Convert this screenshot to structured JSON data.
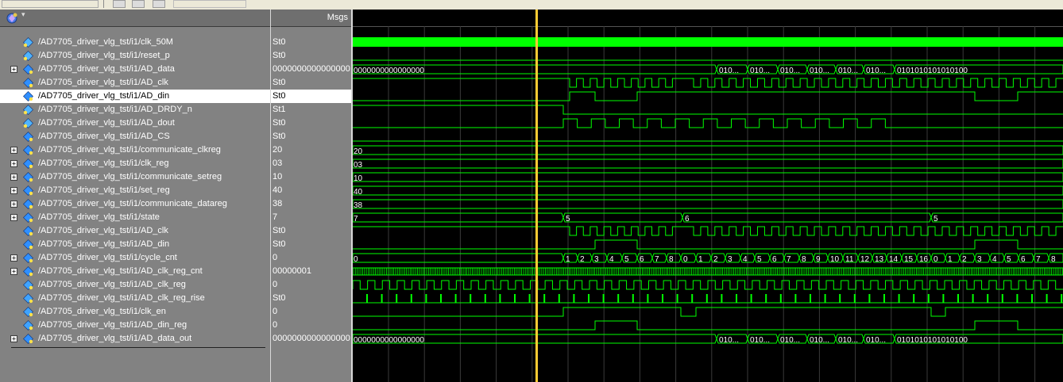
{
  "values_header": "Msgs",
  "cursor_time_fraction": 0.258,
  "colors": {
    "wave": "#00ff00",
    "cursor": "#ffcc33",
    "grid": "#3a3a3a",
    "bus_text": "#ffffff",
    "background": "#000000"
  },
  "signals": [
    {
      "name": "/AD7705_driver_vlg_tst/i1/clk_50M",
      "value": "St0",
      "expandable": false,
      "icon": "input-signal-icon",
      "wave": {
        "kind": "fill"
      }
    },
    {
      "name": "/AD7705_driver_vlg_tst/i1/reset_p",
      "value": "St0",
      "expandable": false,
      "icon": "input-signal-icon",
      "wave": {
        "kind": "low"
      }
    },
    {
      "name": "/AD7705_driver_vlg_tst/i1/AD_data",
      "value": "0000000000000000",
      "expandable": true,
      "icon": "bus-signal-icon",
      "wave": {
        "kind": "bus",
        "segments": [
          {
            "from": 0,
            "to": 458,
            "label": "0000000000000000"
          },
          {
            "from": 458,
            "to": 497,
            "label": "010..."
          },
          {
            "from": 497,
            "to": 535,
            "label": "010..."
          },
          {
            "from": 535,
            "to": 572,
            "label": "010..."
          },
          {
            "from": 572,
            "to": 608,
            "label": "010..."
          },
          {
            "from": 608,
            "to": 643,
            "label": "010..."
          },
          {
            "from": 643,
            "to": 682,
            "label": "010..."
          },
          {
            "from": 682,
            "to": 894,
            "label": "0101010101010100"
          }
        ]
      }
    },
    {
      "name": "/AD7705_driver_vlg_tst/i1/AD_clk",
      "value": "St0",
      "expandable": false,
      "icon": "output-signal-icon",
      "wave": {
        "kind": "clock",
        "idle": "high",
        "bursts": [
          [
            273,
            411,
            8
          ],
          [
            429,
            894,
            26
          ]
        ]
      }
    },
    {
      "name": "/AD7705_driver_vlg_tst/i1/AD_din",
      "value": "St0",
      "expandable": false,
      "icon": "output-signal-icon",
      "selected": true,
      "wave": {
        "kind": "edges",
        "init": 0,
        "edges": [
          273,
          305,
          358,
          783,
          837
        ]
      }
    },
    {
      "name": "/AD7705_driver_vlg_tst/i1/AD_DRDY_n",
      "value": "St1",
      "expandable": false,
      "icon": "input-signal-icon",
      "wave": {
        "kind": "edges",
        "init": 1,
        "edges": [
          265
        ]
      }
    },
    {
      "name": "/AD7705_driver_vlg_tst/i1/AD_dout",
      "value": "St0",
      "expandable": false,
      "icon": "input-signal-icon",
      "wave": {
        "kind": "clock",
        "idle": "low",
        "bursts": [
          [
            265,
            688,
            12
          ]
        ]
      }
    },
    {
      "name": "/AD7705_driver_vlg_tst/i1/AD_CS",
      "value": "St0",
      "expandable": false,
      "icon": "output-signal-icon",
      "wave": {
        "kind": "low"
      }
    },
    {
      "name": "/AD7705_driver_vlg_tst/i1/communicate_clkreg",
      "value": "20",
      "expandable": true,
      "icon": "bus-signal-icon",
      "wave": {
        "kind": "bus",
        "segments": [
          {
            "from": 0,
            "to": 894,
            "label": "20"
          }
        ]
      }
    },
    {
      "name": "/AD7705_driver_vlg_tst/i1/clk_reg",
      "value": "03",
      "expandable": true,
      "icon": "bus-signal-icon",
      "wave": {
        "kind": "bus",
        "segments": [
          {
            "from": 0,
            "to": 894,
            "label": "03"
          }
        ]
      }
    },
    {
      "name": "/AD7705_driver_vlg_tst/i1/communicate_setreg",
      "value": "10",
      "expandable": true,
      "icon": "bus-signal-icon",
      "wave": {
        "kind": "bus",
        "segments": [
          {
            "from": 0,
            "to": 894,
            "label": "10"
          }
        ]
      }
    },
    {
      "name": "/AD7705_driver_vlg_tst/i1/set_reg",
      "value": "40",
      "expandable": true,
      "icon": "bus-signal-icon",
      "wave": {
        "kind": "bus",
        "segments": [
          {
            "from": 0,
            "to": 894,
            "label": "40"
          }
        ]
      }
    },
    {
      "name": "/AD7705_driver_vlg_tst/i1/communicate_datareg",
      "value": "38",
      "expandable": true,
      "icon": "bus-signal-icon",
      "wave": {
        "kind": "bus",
        "segments": [
          {
            "from": 0,
            "to": 894,
            "label": "38"
          }
        ]
      }
    },
    {
      "name": "/AD7705_driver_vlg_tst/i1/state",
      "value": "7",
      "expandable": true,
      "icon": "bus-signal-icon",
      "wave": {
        "kind": "bus",
        "segments": [
          {
            "from": 0,
            "to": 265,
            "label": "7"
          },
          {
            "from": 265,
            "to": 415,
            "label": "5"
          },
          {
            "from": 415,
            "to": 728,
            "label": "6"
          },
          {
            "from": 728,
            "to": 894,
            "label": "5"
          }
        ]
      }
    },
    {
      "name": "/AD7705_driver_vlg_tst/i1/AD_clk",
      "value": "St0",
      "expandable": false,
      "icon": "output-signal-icon",
      "wave": {
        "kind": "clock",
        "idle": "high",
        "bursts": [
          [
            273,
            411,
            8
          ],
          [
            429,
            894,
            26
          ]
        ]
      }
    },
    {
      "name": "/AD7705_driver_vlg_tst/i1/AD_din",
      "value": "St0",
      "expandable": false,
      "icon": "output-signal-icon",
      "wave": {
        "kind": "edges",
        "init": 0,
        "edges": [
          305,
          358,
          783,
          837
        ]
      }
    },
    {
      "name": "/AD7705_driver_vlg_tst/i1/cycle_cnt",
      "value": "0",
      "expandable": true,
      "icon": "bus-signal-icon",
      "wave": {
        "kind": "bus",
        "segments": [
          {
            "from": 0,
            "to": 265,
            "label": "0"
          },
          {
            "from": 265,
            "to": 283,
            "label": "1"
          },
          {
            "from": 283,
            "to": 301,
            "label": "2"
          },
          {
            "from": 301,
            "to": 320,
            "label": "3"
          },
          {
            "from": 320,
            "to": 339,
            "label": "4"
          },
          {
            "from": 339,
            "to": 358,
            "label": "5"
          },
          {
            "from": 358,
            "to": 377,
            "label": "6"
          },
          {
            "from": 377,
            "to": 395,
            "label": "7"
          },
          {
            "from": 395,
            "to": 413,
            "label": "8"
          },
          {
            "from": 413,
            "to": 432,
            "label": "0"
          },
          {
            "from": 432,
            "to": 451,
            "label": "1"
          },
          {
            "from": 451,
            "to": 469,
            "label": "2"
          },
          {
            "from": 469,
            "to": 488,
            "label": "3"
          },
          {
            "from": 488,
            "to": 506,
            "label": "4"
          },
          {
            "from": 506,
            "to": 525,
            "label": "5"
          },
          {
            "from": 525,
            "to": 543,
            "label": "6"
          },
          {
            "from": 543,
            "to": 562,
            "label": "7"
          },
          {
            "from": 562,
            "to": 580,
            "label": "8"
          },
          {
            "from": 580,
            "to": 598,
            "label": "9"
          },
          {
            "from": 598,
            "to": 617,
            "label": "10"
          },
          {
            "from": 617,
            "to": 636,
            "label": "11"
          },
          {
            "from": 636,
            "to": 654,
            "label": "12"
          },
          {
            "from": 654,
            "to": 672,
            "label": "13"
          },
          {
            "from": 672,
            "to": 691,
            "label": "14"
          },
          {
            "from": 691,
            "to": 710,
            "label": "15"
          },
          {
            "from": 710,
            "to": 728,
            "label": "16"
          },
          {
            "from": 728,
            "to": 746,
            "label": "0"
          },
          {
            "from": 746,
            "to": 764,
            "label": "1"
          },
          {
            "from": 764,
            "to": 783,
            "label": "2"
          },
          {
            "from": 783,
            "to": 802,
            "label": "3"
          },
          {
            "from": 802,
            "to": 820,
            "label": "4"
          },
          {
            "from": 820,
            "to": 838,
            "label": "5"
          },
          {
            "from": 838,
            "to": 857,
            "label": "6"
          },
          {
            "from": 857,
            "to": 876,
            "label": "7"
          },
          {
            "from": 876,
            "to": 894,
            "label": "8"
          }
        ]
      }
    },
    {
      "name": "/AD7705_driver_vlg_tst/i1/AD_clk_reg_cnt",
      "value": "00000001",
      "expandable": true,
      "icon": "bus-signal-icon",
      "wave": {
        "kind": "dense"
      }
    },
    {
      "name": "/AD7705_driver_vlg_tst/i1/AD_clk_reg",
      "value": "0",
      "expandable": false,
      "icon": "internal-signal-icon",
      "wave": {
        "kind": "clock",
        "idle": "low",
        "bursts": [
          [
            0,
            894,
            48
          ]
        ]
      }
    },
    {
      "name": "/AD7705_driver_vlg_tst/i1/AD_clk_reg_rise",
      "value": "St0",
      "expandable": false,
      "icon": "internal-signal-icon",
      "wave": {
        "kind": "pulses",
        "period": 18.6,
        "offset": 17,
        "width": 2
      }
    },
    {
      "name": "/AD7705_driver_vlg_tst/i1/clk_en",
      "value": "0",
      "expandable": false,
      "icon": "internal-signal-icon",
      "wave": {
        "kind": "edges",
        "init": 0,
        "edges": [
          265,
          413,
          432,
          728,
          746
        ]
      }
    },
    {
      "name": "/AD7705_driver_vlg_tst/i1/AD_din_reg",
      "value": "0",
      "expandable": false,
      "icon": "internal-signal-icon",
      "wave": {
        "kind": "edges",
        "init": 0,
        "edges": [
          305,
          358,
          783,
          837
        ]
      }
    },
    {
      "name": "/AD7705_driver_vlg_tst/i1/AD_data_out",
      "value": "0000000000000000",
      "expandable": true,
      "icon": "bus-signal-icon",
      "wave": {
        "kind": "bus",
        "segments": [
          {
            "from": 0,
            "to": 458,
            "label": "0000000000000000"
          },
          {
            "from": 458,
            "to": 497,
            "label": "010..."
          },
          {
            "from": 497,
            "to": 535,
            "label": "010..."
          },
          {
            "from": 535,
            "to": 572,
            "label": "010..."
          },
          {
            "from": 572,
            "to": 608,
            "label": "010..."
          },
          {
            "from": 608,
            "to": 643,
            "label": "010..."
          },
          {
            "from": 643,
            "to": 682,
            "label": "010..."
          },
          {
            "from": 682,
            "to": 894,
            "label": "0101010101010100"
          }
        ]
      }
    }
  ]
}
